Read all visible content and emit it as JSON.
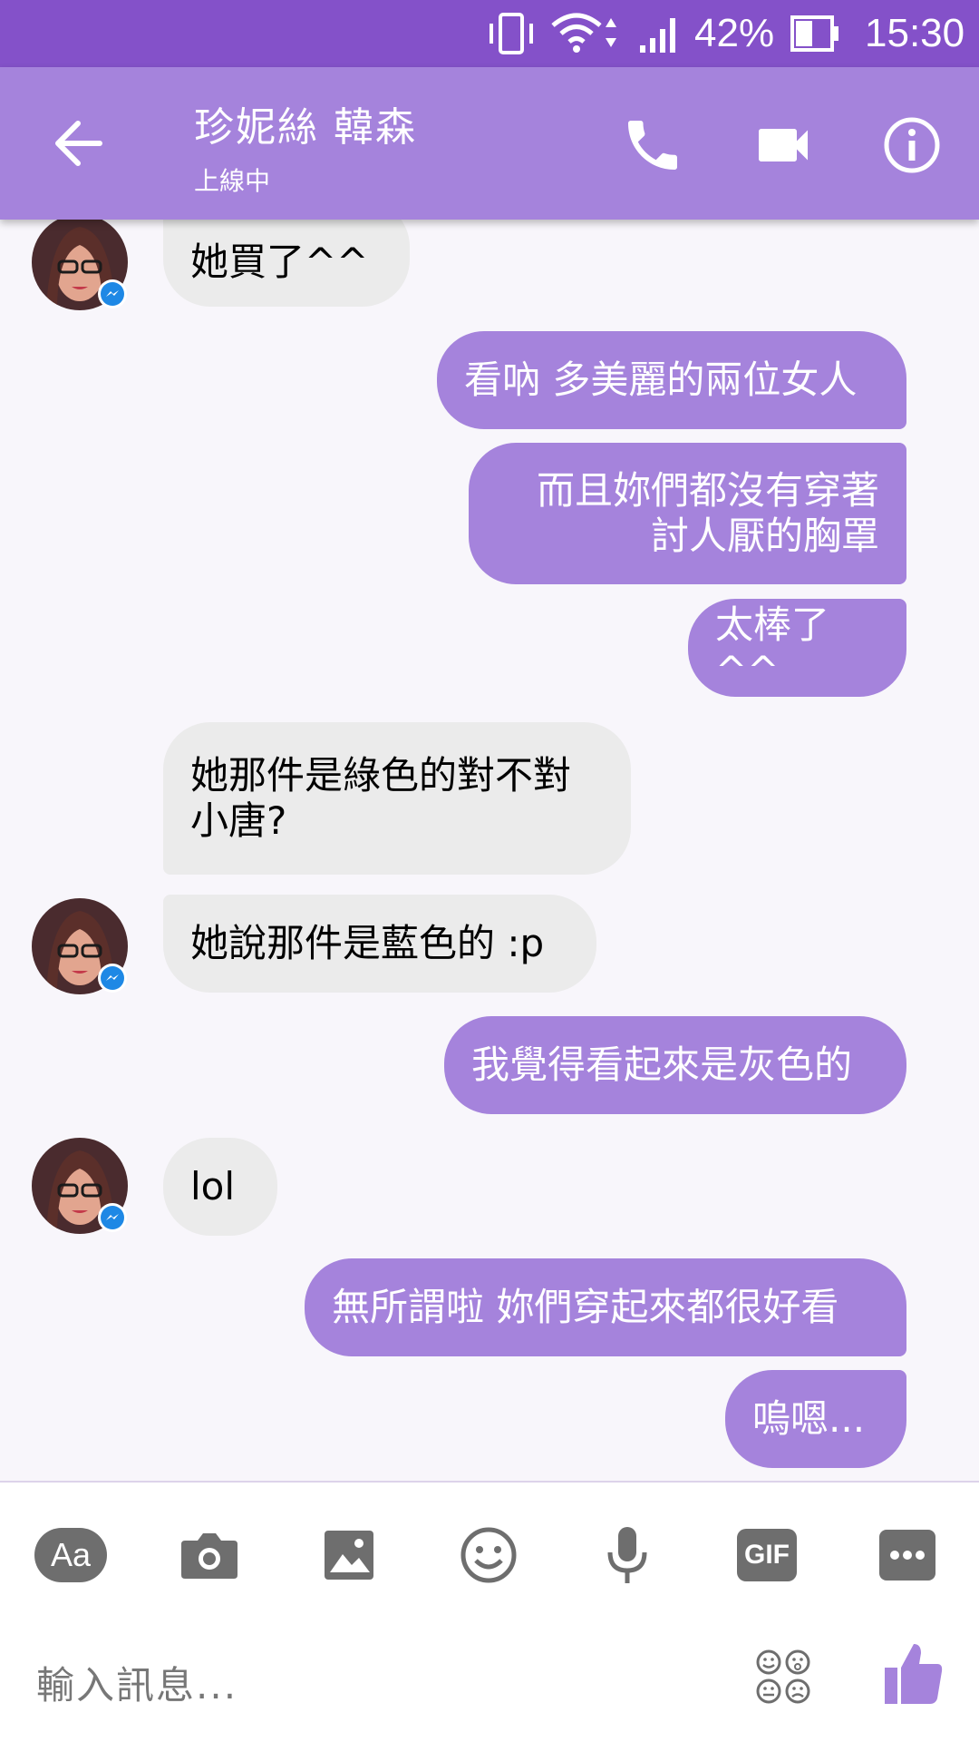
{
  "status_bar": {
    "battery": "42%",
    "time": "15:30",
    "icons": [
      "vibrate-icon",
      "wifi-icon",
      "signal-icon",
      "battery-icon"
    ]
  },
  "header": {
    "title": "珍妮絲 韓森",
    "subtitle": "上線中",
    "icons": [
      "back-arrow-icon",
      "phone-icon",
      "video-camera-icon",
      "info-icon"
    ]
  },
  "messages": [
    {
      "side": "in",
      "text": "她買了^^"
    },
    {
      "side": "out",
      "text": "看吶 多美麗的兩位女人"
    },
    {
      "side": "out",
      "text": "而且妳們都沒有穿著\n討人厭的胸罩"
    },
    {
      "side": "out",
      "text": "太棒了^^"
    },
    {
      "side": "in",
      "text": "她那件是綠色的對不對\n小唐?"
    },
    {
      "side": "in",
      "text": "她說那件是藍色的 :p"
    },
    {
      "side": "out",
      "text": "我覺得看起來是灰色的"
    },
    {
      "side": "in",
      "text": "lol"
    },
    {
      "side": "out",
      "text": "無所謂啦 妳們穿起來都很好看"
    },
    {
      "side": "out",
      "text": "嗚嗯..."
    }
  ],
  "composer": {
    "placeholder": "輸入訊息...",
    "text_button": "Aa",
    "gif_button": "GIF",
    "tools": [
      "text-format-icon",
      "camera-icon",
      "image-icon",
      "emoji-icon",
      "microphone-icon",
      "gif-icon",
      "more-icon"
    ],
    "extra": [
      "sticker-icon",
      "thumbs-up-icon"
    ]
  },
  "colors": {
    "status_bar": "#8451c9",
    "header": "#a583dc",
    "outgoing": "#a583dc",
    "incoming": "#ebebeb",
    "icons": "#6e6e6e"
  }
}
